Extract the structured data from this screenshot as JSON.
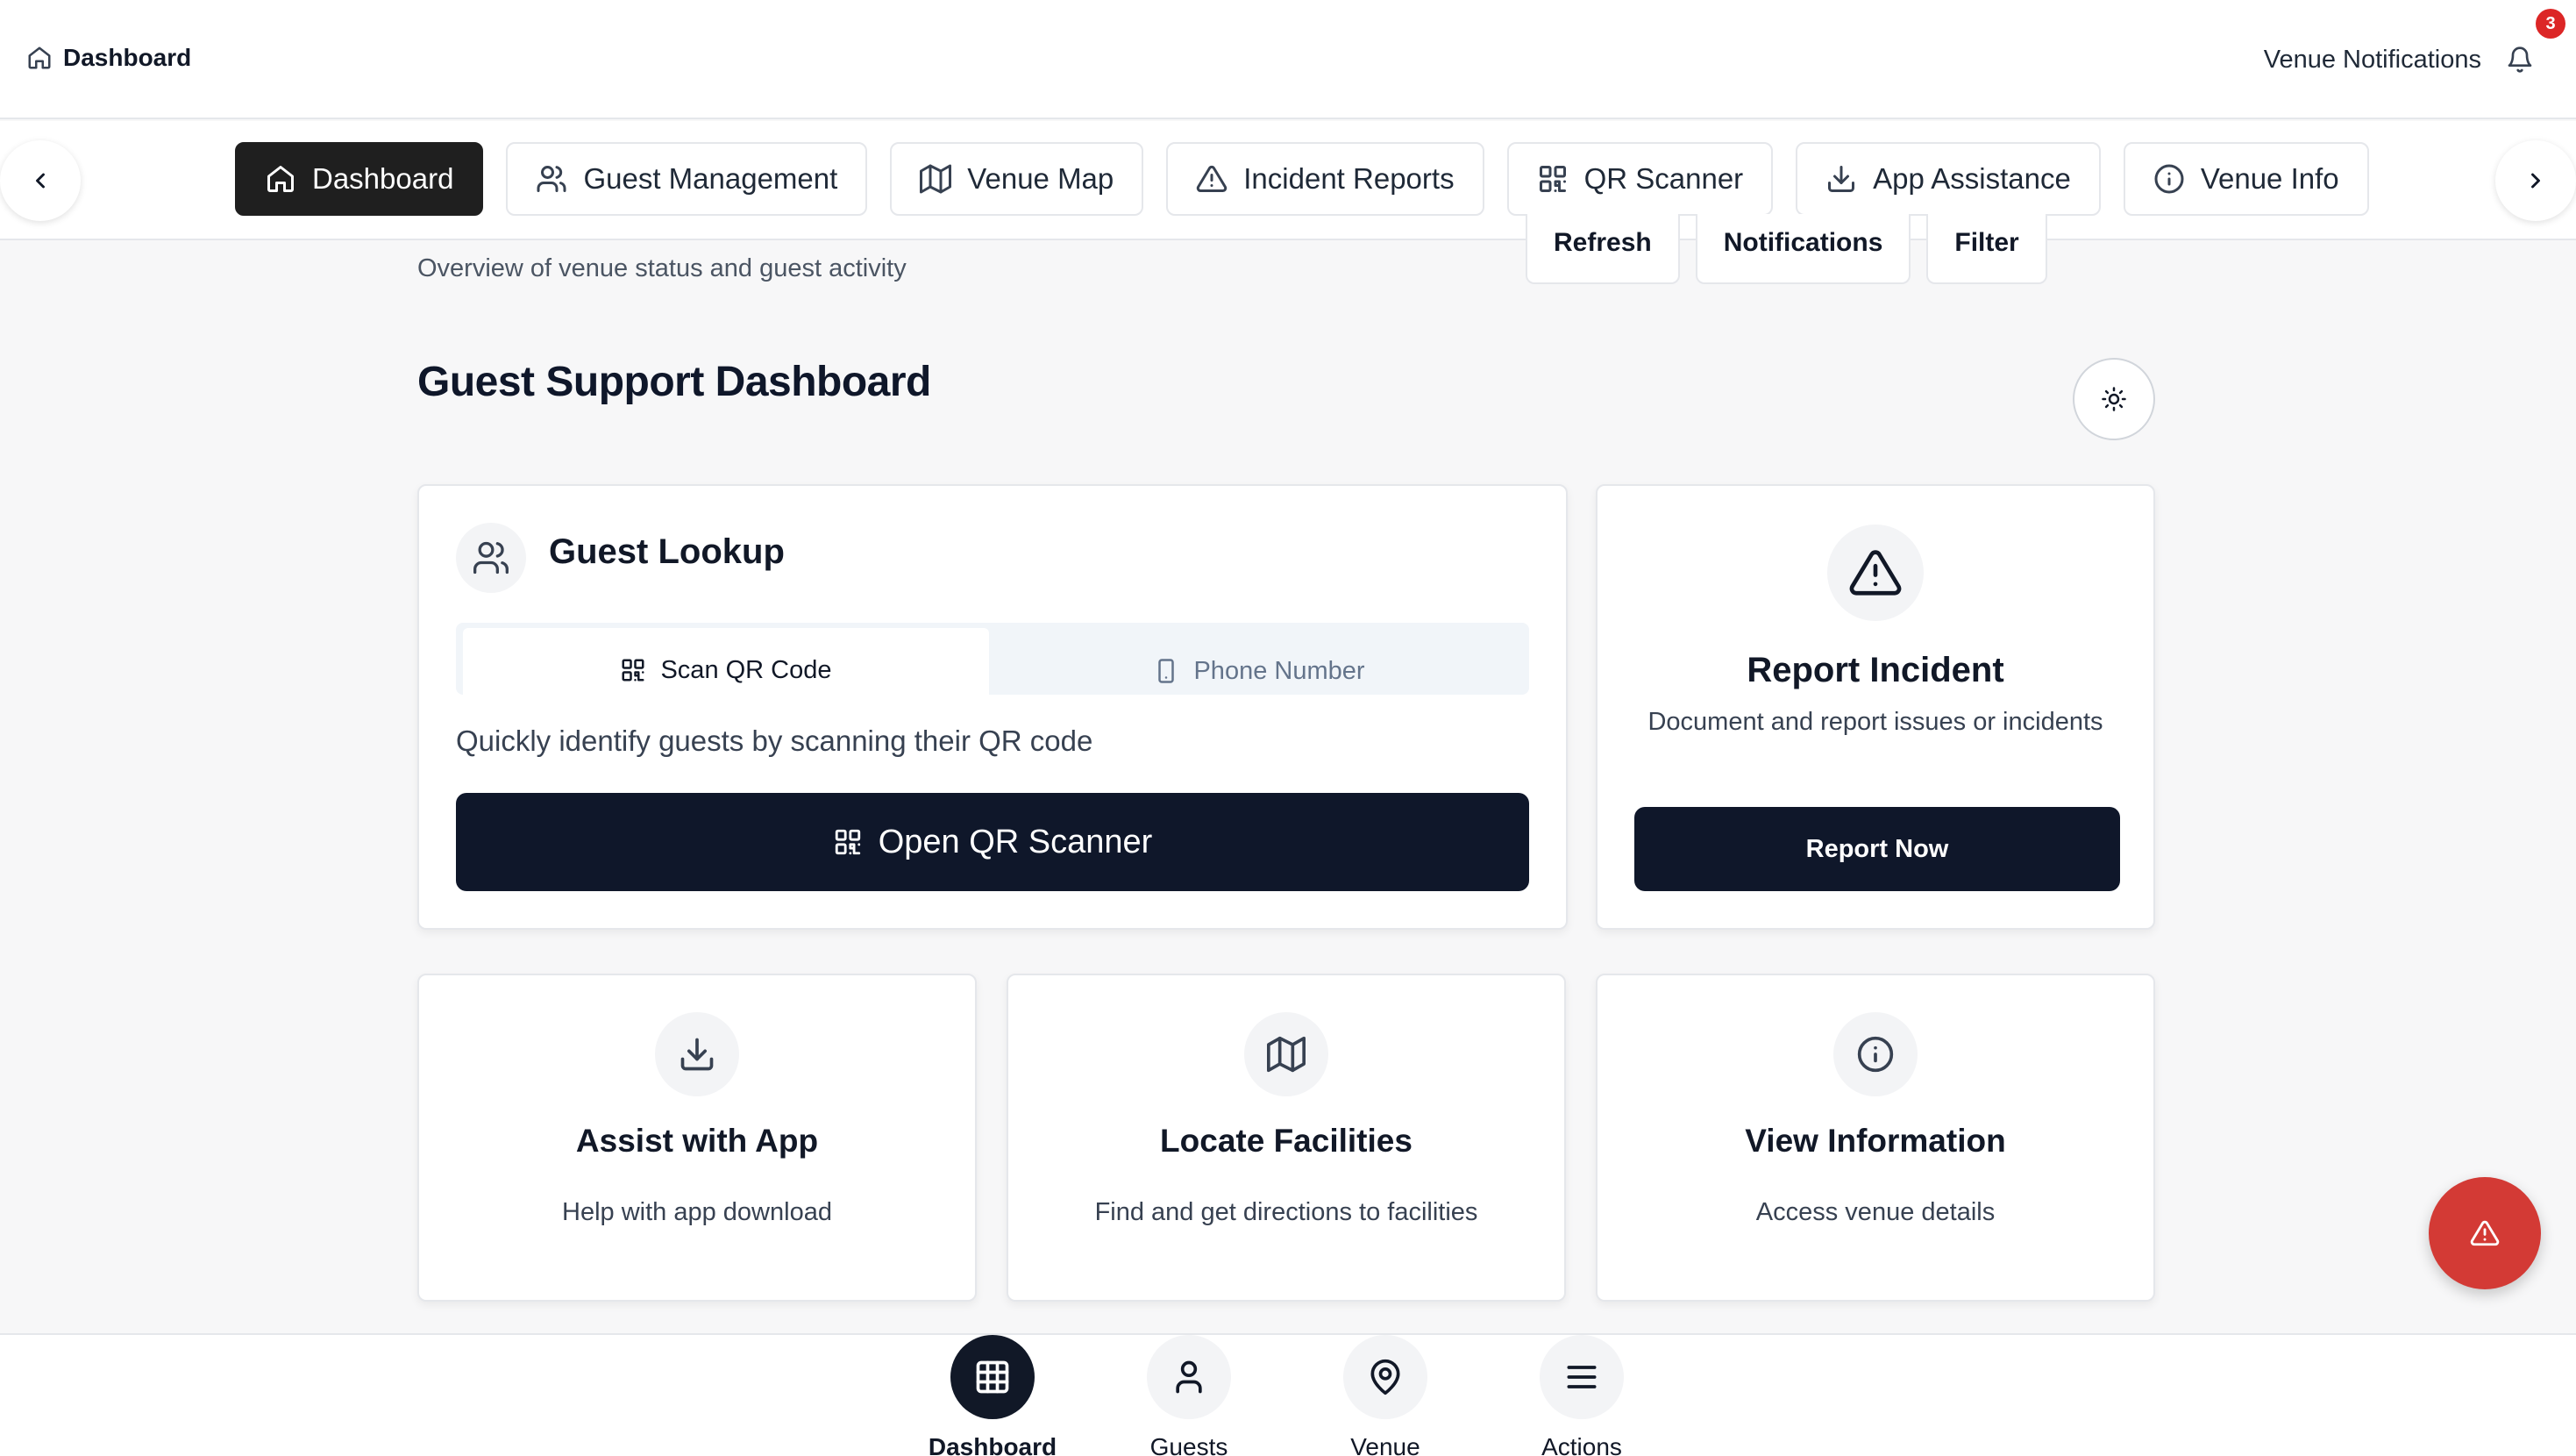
{
  "topbar": {
    "title": "Dashboard",
    "title_icon": "home-icon",
    "notifications_label": "Venue Notifications",
    "notification_count": "3"
  },
  "nav": {
    "tabs": [
      {
        "label": "Dashboard",
        "icon": "home-icon",
        "active": true
      },
      {
        "label": "Guest Management",
        "icon": "users-icon"
      },
      {
        "label": "Venue Map",
        "icon": "map-icon"
      },
      {
        "label": "Incident Reports",
        "icon": "alert-triangle-icon"
      },
      {
        "label": "QR Scanner",
        "icon": "qr-code-icon"
      },
      {
        "label": "App Assistance",
        "icon": "download-icon"
      },
      {
        "label": "Venue Info",
        "icon": "info-icon"
      }
    ]
  },
  "actions": {
    "refresh": "Refresh",
    "notifications": "Notifications",
    "filter": "Filter"
  },
  "page": {
    "subtitle": "Overview of venue status and guest activity",
    "title": "Guest Support Dashboard"
  },
  "lookup": {
    "title": "Guest Lookup",
    "tab_qr": "Scan QR Code",
    "tab_phone": "Phone Number",
    "description": "Quickly identify guests by scanning their QR code",
    "button": "Open QR Scanner"
  },
  "report": {
    "title": "Report Incident",
    "description": "Document and report issues or incidents",
    "button": "Report Now"
  },
  "cards": [
    {
      "title": "Assist with App",
      "description": "Help with app download",
      "icon": "download-icon"
    },
    {
      "title": "Locate Facilities",
      "description": "Find and get directions to facilities",
      "icon": "map-icon"
    },
    {
      "title": "View Information",
      "description": "Access venue details",
      "icon": "info-icon"
    }
  ],
  "bottom_nav": [
    {
      "label": "Dashboard",
      "icon": "grid-icon",
      "active": true
    },
    {
      "label": "Guests",
      "icon": "user-icon"
    },
    {
      "label": "Venue",
      "icon": "map-pin-icon"
    },
    {
      "label": "Actions",
      "icon": "menu-icon"
    }
  ],
  "colors": {
    "primary": "#0f172a",
    "danger": "#d33a35",
    "badge": "#dc2626"
  }
}
